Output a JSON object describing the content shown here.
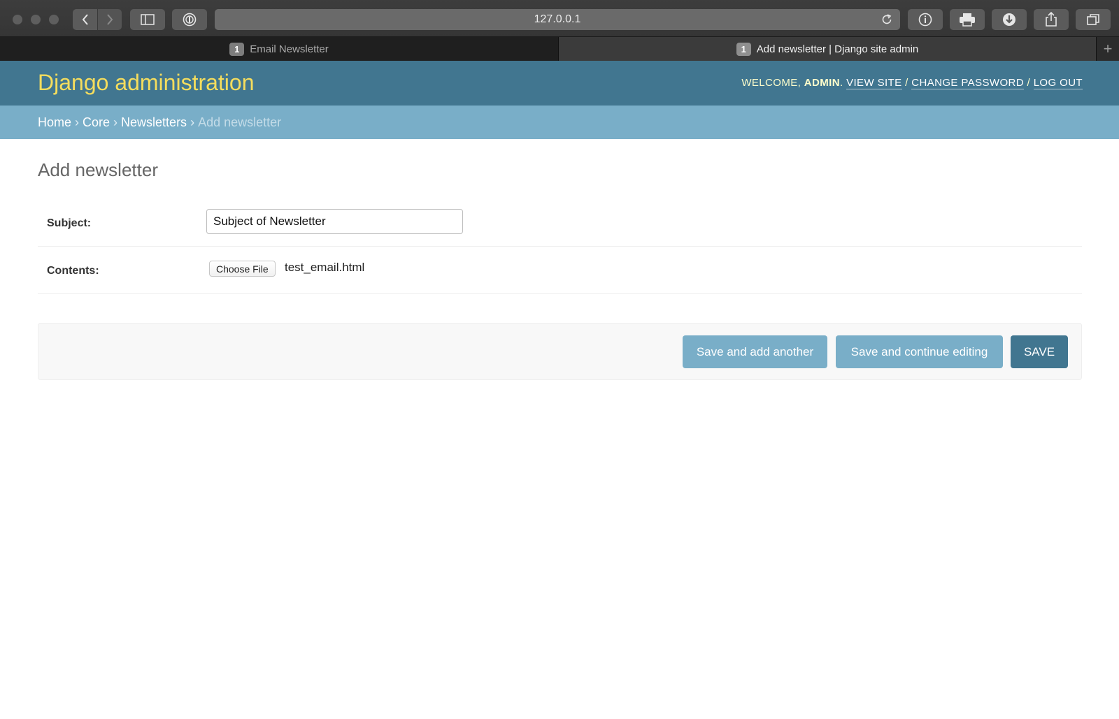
{
  "browser": {
    "url": "127.0.0.1",
    "tabs": [
      {
        "badge": "1",
        "title": "Email Newsletter"
      },
      {
        "badge": "1",
        "title": "Add newsletter | Django site admin"
      }
    ],
    "new_tab_symbol": "+"
  },
  "header": {
    "site_name": "Django administration",
    "welcome_prefix": "WELCOME, ",
    "username": "ADMIN",
    "dot": ". ",
    "view_site": "VIEW SITE",
    "sep": " / ",
    "change_password": "CHANGE PASSWORD",
    "log_out": "LOG OUT"
  },
  "breadcrumbs": {
    "items": [
      "Home",
      "Core",
      "Newsletters"
    ],
    "separator": "›",
    "current": "Add newsletter"
  },
  "page": {
    "title": "Add newsletter"
  },
  "form": {
    "subject_label": "Subject:",
    "subject_value": "Subject of Newsletter",
    "contents_label": "Contents:",
    "file_button": "Choose File",
    "file_name": "test_email.html"
  },
  "actions": {
    "save_add_another": "Save and add another",
    "save_continue": "Save and continue editing",
    "save": "SAVE"
  },
  "colors": {
    "header_bg": "#417690",
    "breadcrumb_bg": "#79aec8",
    "site_name": "#f5dd5d"
  }
}
